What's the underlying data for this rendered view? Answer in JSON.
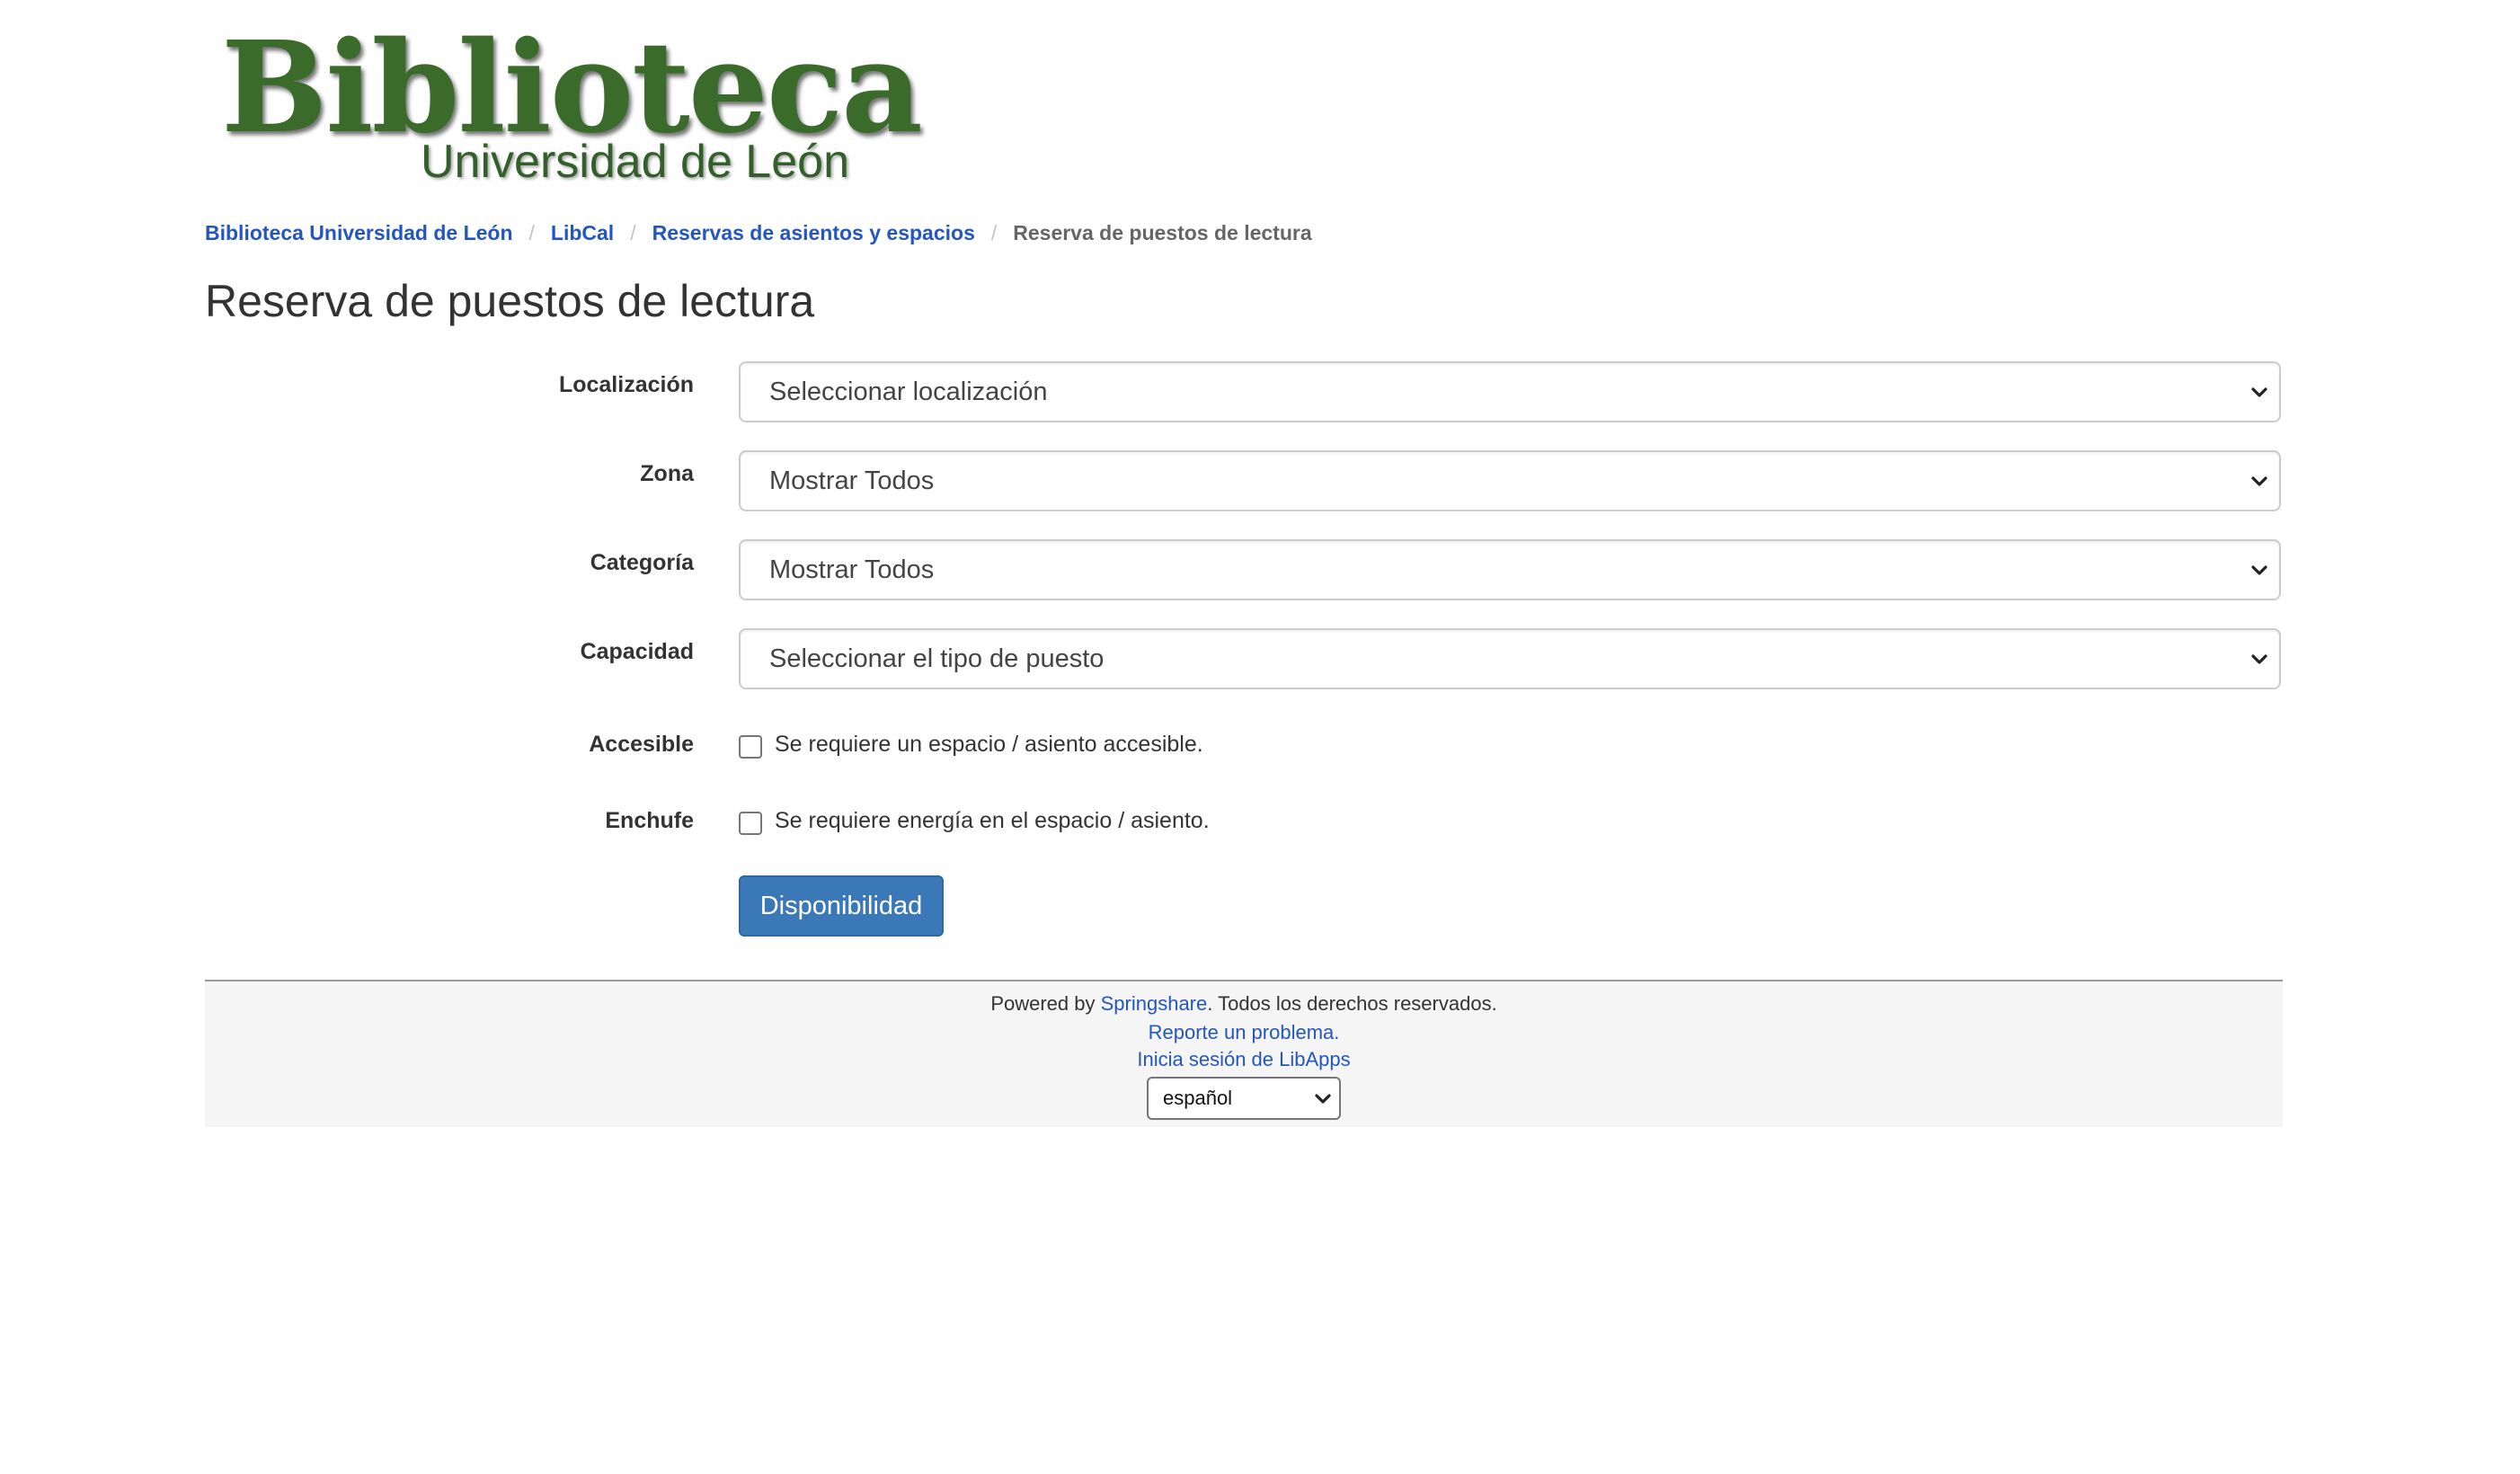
{
  "logo": {
    "main_text": "Biblioteca",
    "sub_text": "Universidad de León"
  },
  "breadcrumb": [
    {
      "label": "Biblioteca Universidad de León"
    },
    {
      "label": "LibCal"
    },
    {
      "label": "Reservas de asientos y espacios"
    },
    {
      "label": "Reserva de puestos de lectura"
    }
  ],
  "page_title": "Reserva de puestos de lectura",
  "form": {
    "location": {
      "label": "Localización",
      "value": "Seleccionar localización"
    },
    "zone": {
      "label": "Zona",
      "value": "Mostrar Todos"
    },
    "category": {
      "label": "Categoría",
      "value": "Mostrar Todos"
    },
    "capacity": {
      "label": "Capacidad",
      "value": "Seleccionar el tipo de puesto"
    },
    "accessible": {
      "label": "Accesible",
      "text": "Se requiere un espacio / asiento accesible.",
      "checked": false
    },
    "power": {
      "label": "Enchufe",
      "text": "Se requiere energía en el espacio / asiento.",
      "checked": false
    },
    "submit_label": "Disponibilidad"
  },
  "footer": {
    "powered_by": "Powered by ",
    "springshare_link": "Springshare",
    "rights": ". Todos los derechos reservados.",
    "report_link": "Reporte un problema.",
    "login_link": "Inicia sesión de LibApps",
    "language_value": "español"
  },
  "colors": {
    "link": "#2456c2",
    "button": "#3b78b8",
    "logo_green": "#3a6b2a",
    "footer_bg": "#f5f5f5"
  },
  "icons": {
    "select_arrow": "chevron-down-icon",
    "checkbox": "checkbox-unchecked"
  }
}
